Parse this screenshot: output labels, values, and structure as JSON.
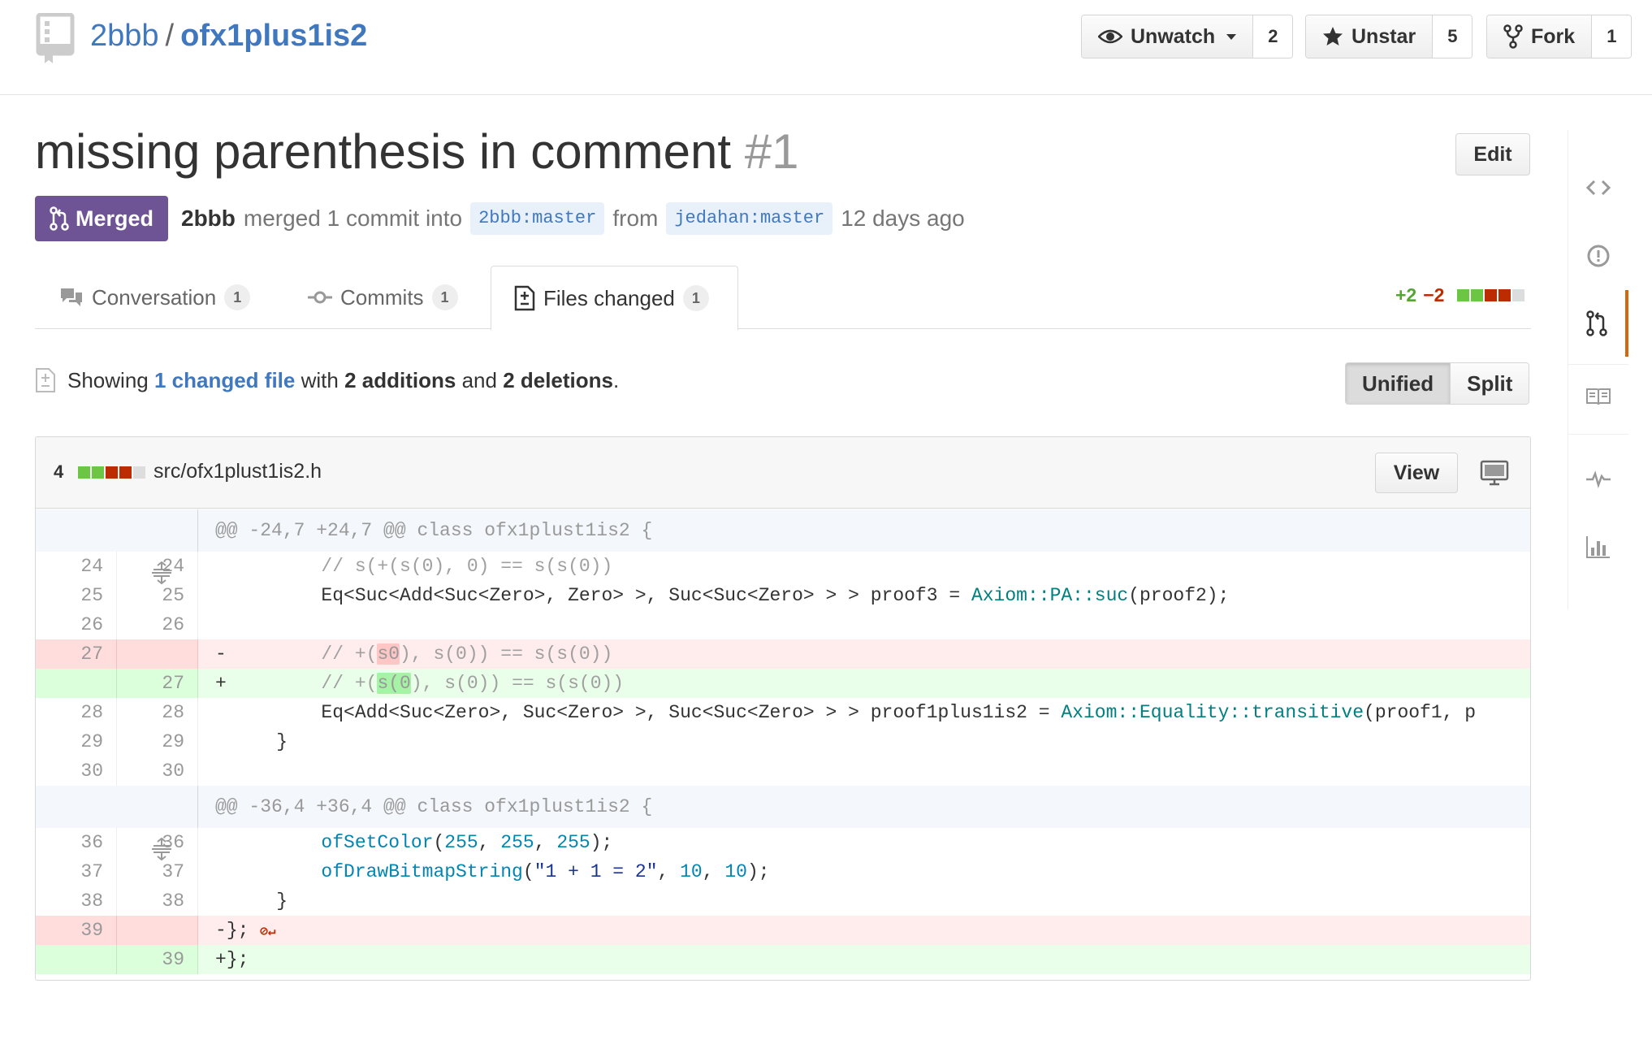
{
  "repo": {
    "owner": "2bbb",
    "separator": "/",
    "name": "ofx1plus1is2"
  },
  "header_actions": {
    "watch": {
      "label": "Unwatch",
      "count": "2"
    },
    "star": {
      "label": "Unstar",
      "count": "5"
    },
    "fork": {
      "label": "Fork",
      "count": "1"
    }
  },
  "pull_request": {
    "title": "missing parenthesis in comment",
    "number": "#1",
    "edit_label": "Edit",
    "state": "Merged",
    "author": "2bbb",
    "action_text": "merged 1 commit into",
    "base_branch": "2bbb:master",
    "from_text": "from",
    "head_branch": "jedahan:master",
    "time": "12 days ago"
  },
  "tabs": [
    {
      "label": "Conversation",
      "count": "1",
      "selected": false
    },
    {
      "label": "Commits",
      "count": "1",
      "selected": false
    },
    {
      "label": "Files changed",
      "count": "1",
      "selected": true
    }
  ],
  "diffstat": {
    "additions": "+2",
    "deletions": "−2"
  },
  "summary": {
    "showing": "Showing",
    "changed_files": "1 changed file",
    "with": "with",
    "additions": "2 additions",
    "and": "and",
    "deletions": "2 deletions",
    "period": "."
  },
  "view_toggle": {
    "unified": "Unified",
    "split": "Split",
    "selected": "Unified"
  },
  "file": {
    "change_count": "4",
    "path": "src/ofx1plust1is2.h",
    "view_label": "View",
    "hunks": [
      "@@ -24,7 +24,7 @@ class ofx1plust1is2 {",
      "@@ -36,4 +36,4 @@ class ofx1plust1is2 {"
    ],
    "lines": [
      {
        "old": "24",
        "new": "24",
        "type": "ctx"
      },
      {
        "old": "25",
        "new": "25",
        "type": "ctx"
      },
      {
        "old": "26",
        "new": "26",
        "type": "ctx"
      },
      {
        "old": "27",
        "new": "",
        "type": "del"
      },
      {
        "old": "",
        "new": "27",
        "type": "add"
      },
      {
        "old": "28",
        "new": "28",
        "type": "ctx"
      },
      {
        "old": "29",
        "new": "29",
        "type": "ctx"
      },
      {
        "old": "30",
        "new": "30",
        "type": "ctx"
      },
      {
        "old": "36",
        "new": "36",
        "type": "ctx"
      },
      {
        "old": "37",
        "new": "37",
        "type": "ctx"
      },
      {
        "old": "38",
        "new": "38",
        "type": "ctx"
      },
      {
        "old": "39",
        "new": "",
        "type": "del"
      },
      {
        "old": "",
        "new": "39",
        "type": "add"
      }
    ],
    "code": {
      "l24": "        // s(+(s(0), 0) == s(s(0))",
      "l25_a": "        Eq<Suc<Add<Suc<Zero>, Zero> >, Suc<Suc<Zero> > > proof3 = ",
      "l25_b": "Axiom::PA::suc",
      "l25_c": "(proof2);",
      "l27_del_a": "        // +(",
      "l27_del_b": "s0",
      "l27_del_c": "), s(0)) == s(s(0))",
      "l27_add_a": "        // +(",
      "l27_add_b": "s(0",
      "l27_add_c": "), s(0)) == s(s(0))",
      "l28_a": "        Eq<Add<Suc<Zero>, Suc<Zero> >, Suc<Suc<Zero> > > proof1plus1is2 = ",
      "l28_b": "Axiom::Equality::transitive",
      "l28_c": "(proof1, p",
      "l29": "    }",
      "l30": "",
      "l36_fn": "ofSetColor",
      "l36_a": "(",
      "l36_n1": "255",
      "l36_c1": ", ",
      "l36_n2": "255",
      "l36_c2": ", ",
      "l36_n3": "255",
      "l36_end": ");",
      "l37_fn": "ofDrawBitmapString",
      "l37_a": "(",
      "l37_str": "\"1 + 1 = 2\"",
      "l37_c1": ", ",
      "l37_n1": "10",
      "l37_c2": ", ",
      "l37_n2": "10",
      "l37_end": ");",
      "l38": "    }",
      "l39_del": "};",
      "l39_noeol": "⊘↵",
      "l39_add": "};"
    }
  },
  "colors": {
    "link": "#4078c0",
    "merged": "#6e5494",
    "addition": "#55a532",
    "deletion": "#bd2c00",
    "nav_selected": "#d26911"
  },
  "icons": {
    "repo": "repo-icon",
    "watch": "eye-icon",
    "star": "star-icon",
    "fork": "fork-icon",
    "merged": "git-merge-icon",
    "conversation": "comment-discussion-icon",
    "commits": "git-commit-icon",
    "files": "file-diff-icon",
    "expand": "unfold-icon",
    "display": "device-desktop-icon",
    "nav": [
      "code-icon",
      "issue-opened-icon",
      "git-pull-request-icon",
      "book-icon",
      "pulse-icon",
      "graph-icon"
    ]
  }
}
